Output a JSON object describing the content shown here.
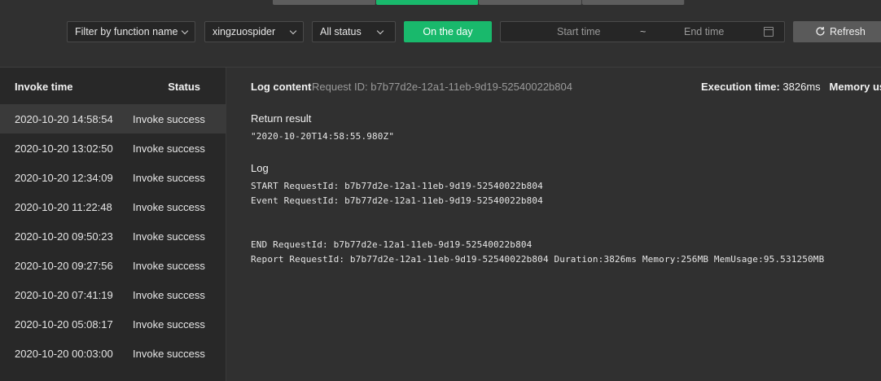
{
  "tabs": [
    {
      "label": "",
      "active": false
    },
    {
      "label": "",
      "active": true
    },
    {
      "label": "",
      "active": false
    },
    {
      "label": "",
      "active": false
    }
  ],
  "toolbar": {
    "function_filter": "Filter by function name",
    "function_value": "xingzuospider",
    "status_value": "All status",
    "on_the_day": "On the day",
    "start_time_placeholder": "Start time",
    "range_separator": "~",
    "end_time_placeholder": "End time",
    "refresh": "Refresh"
  },
  "list": {
    "col_time": "Invoke time",
    "col_status": "Status",
    "rows": [
      {
        "time": "2020-10-20 14:58:54",
        "status": "Invoke success"
      },
      {
        "time": "2020-10-20 13:02:50",
        "status": "Invoke success"
      },
      {
        "time": "2020-10-20 12:34:09",
        "status": "Invoke success"
      },
      {
        "time": "2020-10-20 11:22:48",
        "status": "Invoke success"
      },
      {
        "time": "2020-10-20 09:50:23",
        "status": "Invoke success"
      },
      {
        "time": "2020-10-20 09:27:56",
        "status": "Invoke success"
      },
      {
        "time": "2020-10-20 07:41:19",
        "status": "Invoke success"
      },
      {
        "time": "2020-10-20 05:08:17",
        "status": "Invoke success"
      },
      {
        "time": "2020-10-20 00:03:00",
        "status": "Invoke success"
      }
    ]
  },
  "log": {
    "title": "Log content",
    "request_id": "Request ID: b7b77d2e-12a1-11eb-9d19-52540022b804",
    "exec_label": "Execution time:",
    "exec_value": "3826ms",
    "memory_label": "Memory usa",
    "return_title": "Return result",
    "return_value": "\"2020-10-20T14:58:55.980Z\"",
    "log_title": "Log",
    "lines": [
      "START RequestId: b7b77d2e-12a1-11eb-9d19-52540022b804",
      "Event RequestId: b7b77d2e-12a1-11eb-9d19-52540022b804",
      "END RequestId: b7b77d2e-12a1-11eb-9d19-52540022b804",
      "Report RequestId: b7b77d2e-12a1-11eb-9d19-52540022b804 Duration:3826ms Memory:256MB MemUsage:95.531250MB"
    ]
  },
  "colors": {
    "accent": "#19b96c",
    "background": "#303030",
    "panel": "#282828"
  }
}
